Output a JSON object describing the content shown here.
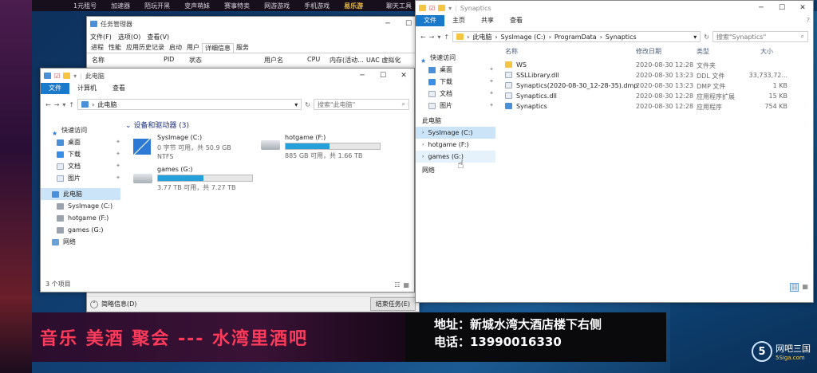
{
  "topbar": {
    "items": [
      "1元租号",
      "加速器",
      "陌玩开黑",
      "变声萌妹",
      "赛事特卖",
      "网游游戏",
      "手机游戏",
      "易乐游",
      "聊天工具"
    ]
  },
  "task_manager": {
    "title": "任务管理器",
    "menu": [
      "文件(F)",
      "选项(O)",
      "查看(V)"
    ],
    "tabs": [
      "进程",
      "性能",
      "应用历史记录",
      "启动",
      "用户",
      "详细信息",
      "服务"
    ],
    "columns": [
      "名称",
      "PID",
      "状态",
      "用户名",
      "CPU",
      "内存(活动...",
      "UAC 虚拟化"
    ],
    "footer_left": "简略信息(D)",
    "end_task": "结束任务(E)"
  },
  "this_pc": {
    "title": "此电脑",
    "ribbon": [
      "文件",
      "计算机",
      "查看"
    ],
    "address": "此电脑",
    "search_placeholder": "搜索\"此电脑\"",
    "nav": {
      "quick_access": "快速访问",
      "desktop": "桌面",
      "downloads": "下载",
      "documents": "文档",
      "pictures": "图片",
      "this_pc": "此电脑",
      "drive_c": "SysImage (C:)",
      "drive_f": "hotgame (F:)",
      "drive_g": "games (G:)",
      "network": "网络"
    },
    "section": "设备和驱动器 (3)",
    "drives": [
      {
        "name": "SysImage (C:)",
        "detail": "0 字节 可用，共 50.9 GB",
        "fs": "NTFS",
        "used_fraction": 1.0
      },
      {
        "name": "hotgame (F:)",
        "detail": "885 GB 可用，共 1.66 TB",
        "used_fraction": 0.47
      },
      {
        "name": "games (G:)",
        "detail": "3.77 TB 可用，共 7.27 TB",
        "used_fraction": 0.48
      }
    ],
    "status": "3 个项目"
  },
  "synaptics": {
    "title": "Synaptics",
    "ribbon": [
      "文件",
      "主页",
      "共享",
      "查看"
    ],
    "breadcrumb": [
      "此电脑",
      "SysImage (C:)",
      "ProgramData",
      "Synaptics"
    ],
    "search_placeholder": "搜索\"Synaptics\"",
    "nav": {
      "quick_access": "快速访问",
      "desktop": "桌面",
      "downloads": "下载",
      "documents": "文档",
      "pictures": "图片",
      "this_pc": "此电脑",
      "drive_c": "SysImage (C:)",
      "drive_f": "hotgame (F:)",
      "drive_g": "games (G:)",
      "network": "网络"
    },
    "columns": [
      "名称",
      "修改日期",
      "类型",
      "大小"
    ],
    "files": [
      {
        "name": "WS",
        "date": "2020-08-30 12:28",
        "type": "文件夹",
        "size": "",
        "icon": "folder"
      },
      {
        "name": "SSLLibrary.dll",
        "date": "2020-08-30 13:23",
        "type": "DDL 文件",
        "size": "33,733,72...",
        "icon": "doc"
      },
      {
        "name": "Synaptics(2020-08-30_12-28-35).dmp",
        "date": "2020-08-30 13:23",
        "type": "DMP 文件",
        "size": "1 KB",
        "icon": "doc"
      },
      {
        "name": "Synaptics.dll",
        "date": "2020-08-30 12:28",
        "type": "应用程序扩展",
        "size": "15 KB",
        "icon": "doc"
      },
      {
        "name": "Synaptics",
        "date": "2020-08-30 12:28",
        "type": "应用程序",
        "size": "754 KB",
        "icon": "app"
      }
    ]
  },
  "banner": {
    "left": "音乐 美酒 聚会 --- 水湾里酒吧",
    "address": "地址：新城水湾大酒店楼下右侧",
    "phone": "电话：13990016330"
  },
  "logo": {
    "text": "网吧三国",
    "sub": "5Siga.com",
    "mark": "5"
  }
}
